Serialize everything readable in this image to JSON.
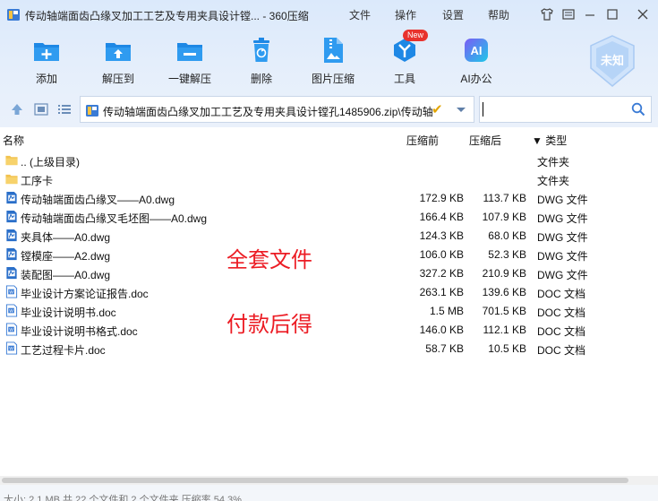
{
  "window": {
    "title": "传动轴端面齿凸缘叉加工工艺及专用夹具设计镗... - 360压缩",
    "menu": [
      "文件",
      "操作",
      "设置",
      "帮助"
    ]
  },
  "toolbar": {
    "items": [
      {
        "label": "添加",
        "icon": "add-icon"
      },
      {
        "label": "解压到",
        "icon": "extract-to-icon"
      },
      {
        "label": "一键解压",
        "icon": "one-click-extract-icon"
      },
      {
        "label": "删除",
        "icon": "delete-icon"
      },
      {
        "label": "图片压缩",
        "icon": "image-compress-icon"
      },
      {
        "label": "工具",
        "icon": "tools-icon"
      },
      {
        "label": "AI办公",
        "icon": "ai-office-icon"
      }
    ],
    "new_badge": "New",
    "ai_glyph": "AI",
    "unknown_badge": "未知"
  },
  "address": {
    "path": "传动轴端面齿凸缘叉加工工艺及专用夹具设计镗孔1485906.zip\\传动轴",
    "search_value": ""
  },
  "columns": {
    "name": "名称",
    "packed": "压缩前",
    "size": "压缩后",
    "type": "▼ 类型"
  },
  "files": [
    {
      "name": ".. (上级目录)",
      "packed": "",
      "size": "",
      "type": "文件夹",
      "icon": "folder-icon"
    },
    {
      "name": "工序卡",
      "packed": "",
      "size": "",
      "type": "文件夹",
      "icon": "folder-icon"
    },
    {
      "name": "传动轴端面齿凸缘叉——A0.dwg",
      "packed": "172.9 KB",
      "size": "113.7 KB",
      "type": "DWG 文件",
      "icon": "dwg-file-icon"
    },
    {
      "name": "传动轴端面齿凸缘叉毛坯图——A0.dwg",
      "packed": "166.4 KB",
      "size": "107.9 KB",
      "type": "DWG 文件",
      "icon": "dwg-file-icon"
    },
    {
      "name": "夹具体——A0.dwg",
      "packed": "124.3 KB",
      "size": "68.0 KB",
      "type": "DWG 文件",
      "icon": "dwg-file-icon"
    },
    {
      "name": "镗模座——A2.dwg",
      "packed": "106.0 KB",
      "size": "52.3 KB",
      "type": "DWG 文件",
      "icon": "dwg-file-icon"
    },
    {
      "name": "装配图——A0.dwg",
      "packed": "327.2 KB",
      "size": "210.9 KB",
      "type": "DWG 文件",
      "icon": "dwg-file-icon"
    },
    {
      "name": "毕业设计方案论证报告.doc",
      "packed": "263.1 KB",
      "size": "139.6 KB",
      "type": "DOC 文档",
      "icon": "doc-file-icon"
    },
    {
      "name": "毕业设计说明书.doc",
      "packed": "1.5 MB",
      "size": "701.5 KB",
      "type": "DOC 文档",
      "icon": "doc-file-icon"
    },
    {
      "name": "毕业设计说明书格式.doc",
      "packed": "146.0 KB",
      "size": "112.1 KB",
      "type": "DOC 文档",
      "icon": "doc-file-icon"
    },
    {
      "name": "工艺过程卡片.doc",
      "packed": "58.7 KB",
      "size": "10.5 KB",
      "type": "DOC 文档",
      "icon": "doc-file-icon"
    }
  ],
  "overlay": {
    "line1": "全套文件",
    "line2": "付款后得"
  },
  "status": "大小: 2.1 MB 共 22 个文件和 2 个文件夹 压缩率 54.3%",
  "colors": {
    "accent": "#1e88e5",
    "overlay_text": "#ec1c24",
    "header_bg": "#dbe9fb"
  }
}
